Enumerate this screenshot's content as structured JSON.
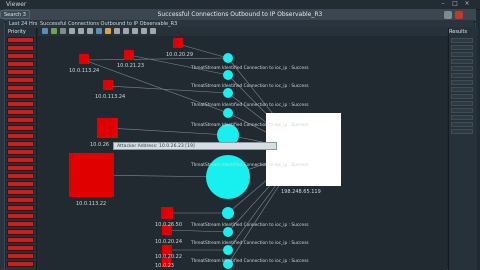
{
  "app": {
    "title": "Viewer"
  },
  "search_tab": {
    "label": "Search 3"
  },
  "window": {
    "title": "Successful Connections Outbound to IP Observable_R3"
  },
  "subtabs": [
    {
      "label": "Last 24 Hrs"
    },
    {
      "label": "Successful Connections Outbound to IP Observable_R3"
    }
  ],
  "left_panel": {
    "header": "Priority"
  },
  "right_panel": {
    "header": "Results"
  },
  "tooltip": {
    "text": "Attacker Address: 10.0.26.23 [19]"
  },
  "nodes": {
    "source_labels": [
      "10.0.20.29",
      "10.0.113.24",
      "10.0.21.23",
      "10.0.113.24",
      "10.0.26",
      "10.0.113.22",
      "10.0.26.50",
      "10.0.20.24",
      "10.0.20.22",
      "10.0.23"
    ],
    "target_label": "198.248.65.119"
  },
  "edge_label": "ThreatStream Identified Connection to ioc_ip : Success",
  "colors": {
    "source": "#e00000",
    "event": "#18f0f0",
    "target": "#ffffff",
    "accent": "#c91f1f"
  }
}
